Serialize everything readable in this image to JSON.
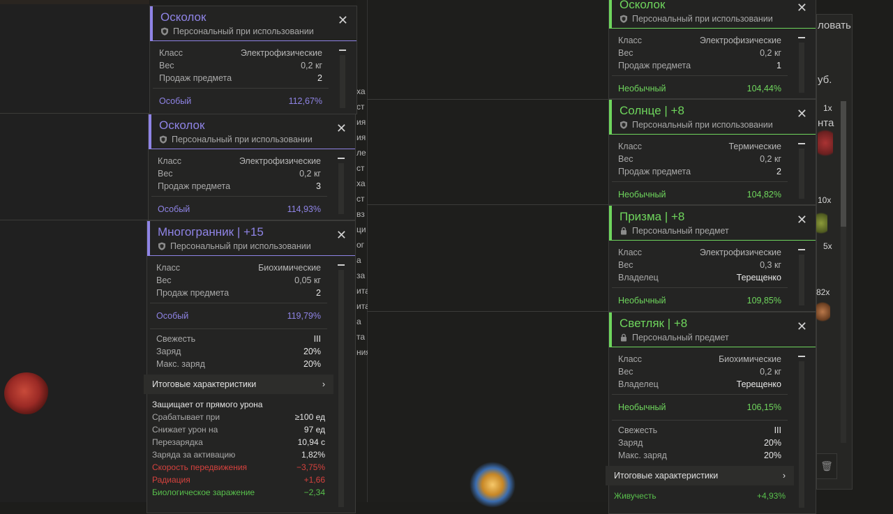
{
  "colors": {
    "epic": "#8f84e6",
    "uncommon": "#6fd65d",
    "red": "#d6423e",
    "green": "#58c04c"
  },
  "left_cards": [
    {
      "title": "Осколок",
      "binding": "Персональный при использовании",
      "binding_icon": "shield-icon",
      "rows": [
        [
          "Класс",
          "Электрофизические"
        ],
        [
          "Вес",
          "0,2 кг"
        ],
        [
          "Продаж предмета",
          "2"
        ]
      ],
      "rarity": "Особый",
      "rarity_value": "112,67%"
    },
    {
      "title": "Осколок",
      "binding": "Персональный при использовании",
      "binding_icon": "shield-icon",
      "rows": [
        [
          "Класс",
          "Электрофизические"
        ],
        [
          "Вес",
          "0,2 кг"
        ],
        [
          "Продаж предмета",
          "3"
        ]
      ],
      "rarity": "Особый",
      "rarity_value": "114,93%"
    },
    {
      "title": "Многогранник | +15",
      "binding": "Персональный при использовании",
      "binding_icon": "shield-icon",
      "rows": [
        [
          "Класс",
          "Биохимические"
        ],
        [
          "Вес",
          "0,05 кг"
        ],
        [
          "Продаж предмета",
          "2"
        ]
      ],
      "rarity": "Особый",
      "rarity_value": "119,79%",
      "stats": [
        [
          "Свежесть",
          "III"
        ],
        [
          "Заряд",
          "20%"
        ],
        [
          "Макс. заряд",
          "20%"
        ]
      ],
      "totals_label": "Итоговые характеристики",
      "effects_title": "Защищает от прямого урона",
      "effects": [
        [
          "Срабатывает при",
          "≥100 ед"
        ],
        [
          "Снижает урон на",
          "97 ед"
        ],
        [
          "Перезарядка",
          "10,94 с"
        ],
        [
          "Заряда за активацию",
          "1,82%"
        ]
      ],
      "effects_bad": [
        [
          "Скорость передвижения",
          "−3,75%"
        ],
        [
          "Радиация",
          "+1,66"
        ]
      ],
      "effects_good": [
        [
          "Биологическое заражение",
          "−2,34"
        ]
      ]
    }
  ],
  "right_cards": [
    {
      "title": "Осколок",
      "binding": "Персональный при использовании",
      "binding_icon": "shield-icon",
      "rows": [
        [
          "Класс",
          "Электрофизические"
        ],
        [
          "Вес",
          "0,2 кг"
        ],
        [
          "Продаж предмета",
          "1"
        ]
      ],
      "rarity": "Необычный",
      "rarity_value": "104,44%"
    },
    {
      "title": "Солнце | +8",
      "binding": "Персональный при использовании",
      "binding_icon": "shield-icon",
      "rows": [
        [
          "Класс",
          "Термические"
        ],
        [
          "Вес",
          "0,2 кг"
        ],
        [
          "Продаж предмета",
          "2"
        ]
      ],
      "rarity": "Необычный",
      "rarity_value": "104,82%"
    },
    {
      "title": "Призма | +8",
      "binding": "Персональный предмет",
      "binding_icon": "lock-icon",
      "rows": [
        [
          "Класс",
          "Электрофизические"
        ],
        [
          "Вес",
          "0,3 кг"
        ],
        [
          "Владелец",
          "Терещенко"
        ]
      ],
      "rarity": "Необычный",
      "rarity_value": "109,85%"
    },
    {
      "title": "Светляк | +8",
      "binding": "Персональный предмет",
      "binding_icon": "lock-icon",
      "rows": [
        [
          "Класс",
          "Биохимические"
        ],
        [
          "Вес",
          "0,2 кг"
        ],
        [
          "Владелец",
          "Терещенко"
        ]
      ],
      "rarity": "Необычный",
      "rarity_value": "106,15%",
      "stats": [
        [
          "Свежесть",
          "III"
        ],
        [
          "Заряд",
          "20%"
        ],
        [
          "Макс. заряд",
          "20%"
        ]
      ],
      "totals_label": "Итоговые характеристики",
      "effects_good": [
        [
          "Живучесть",
          "+4,93%"
        ]
      ]
    }
  ],
  "background_fragments": {
    "right_top": "ловать",
    "right_2": "уб.",
    "right_3": "нта",
    "counts": [
      "1x",
      "10x",
      "5x",
      "82x"
    ],
    "left_menu": [
      "ха",
      "ст",
      "ия",
      "ия",
      "ле",
      "ст",
      "ха",
      "ст",
      "вз",
      "ци",
      "ог",
      "а",
      "за",
      "ита",
      "ита",
      "а",
      "та",
      "ния"
    ]
  }
}
